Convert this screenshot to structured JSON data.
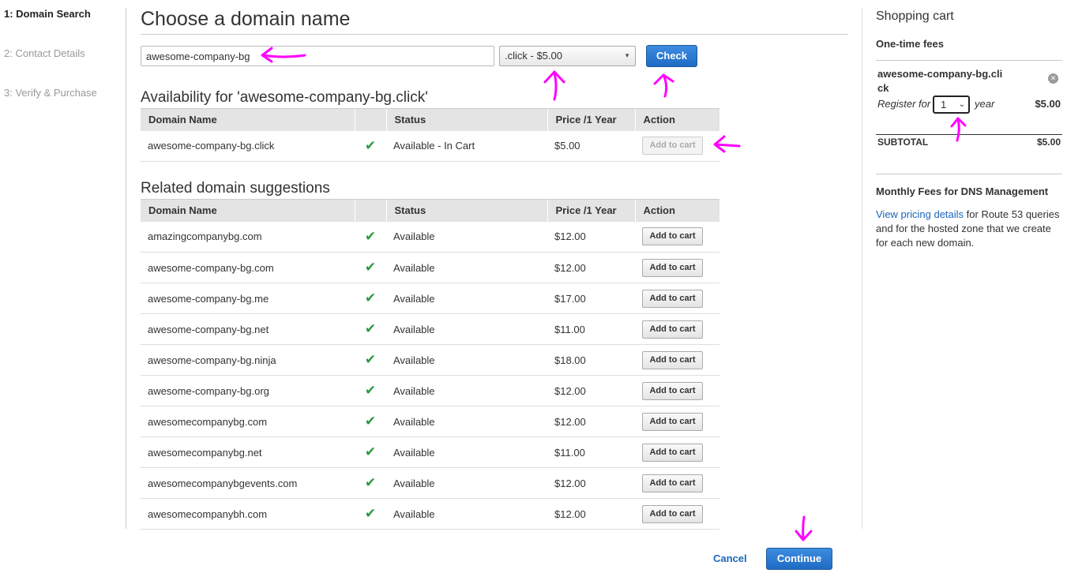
{
  "steps": [
    {
      "label": "1: Domain Search",
      "active": true
    },
    {
      "label": "2: Contact Details",
      "active": false
    },
    {
      "label": "3: Verify & Purchase",
      "active": false
    }
  ],
  "main": {
    "title": "Choose a domain name",
    "search_value": "awesome-company-bg",
    "tld_selected": ".click - $5.00",
    "check_label": "Check"
  },
  "availability": {
    "title": "Availability for 'awesome-company-bg.click'",
    "row": {
      "name": "awesome-company-bg.click",
      "status": "Available - In Cart",
      "price": "$5.00",
      "action": "Add to cart"
    }
  },
  "table_headers": {
    "name": "Domain Name",
    "status": "Status",
    "price": "Price /1 Year",
    "action": "Action"
  },
  "suggestions": {
    "title": "Related domain suggestions",
    "rows": [
      {
        "name": "amazingcompanybg.com",
        "status": "Available",
        "price": "$12.00",
        "action": "Add to cart"
      },
      {
        "name": "awesome-company-bg.com",
        "status": "Available",
        "price": "$12.00",
        "action": "Add to cart"
      },
      {
        "name": "awesome-company-bg.me",
        "status": "Available",
        "price": "$17.00",
        "action": "Add to cart"
      },
      {
        "name": "awesome-company-bg.net",
        "status": "Available",
        "price": "$11.00",
        "action": "Add to cart"
      },
      {
        "name": "awesome-company-bg.ninja",
        "status": "Available",
        "price": "$18.00",
        "action": "Add to cart"
      },
      {
        "name": "awesome-company-bg.org",
        "status": "Available",
        "price": "$12.00",
        "action": "Add to cart"
      },
      {
        "name": "awesomecompanybg.com",
        "status": "Available",
        "price": "$12.00",
        "action": "Add to cart"
      },
      {
        "name": "awesomecompanybg.net",
        "status": "Available",
        "price": "$11.00",
        "action": "Add to cart"
      },
      {
        "name": "awesomecompanybgevents.com",
        "status": "Available",
        "price": "$12.00",
        "action": "Add to cart"
      },
      {
        "name": "awesomecompanybh.com",
        "status": "Available",
        "price": "$12.00",
        "action": "Add to cart"
      }
    ]
  },
  "footer": {
    "cancel_label": "Cancel",
    "continue_label": "Continue"
  },
  "cart": {
    "title": "Shopping cart",
    "one_time_fees": "One-time fees",
    "item_name": "awesome-company-bg.click",
    "register_for": "Register for",
    "years": "1",
    "year_word": "year",
    "item_price": "$5.00",
    "subtotal_label": "SUBTOTAL",
    "subtotal_value": "$5.00",
    "monthly_title": "Monthly Fees for DNS Management",
    "pricing_link": "View pricing details",
    "monthly_text": " for Route 53 queries and for the hosted zone that we create for each new domain."
  },
  "colors": {
    "accent": "#1e6bc4",
    "annotation": "#ff00ff",
    "check_green": "#2c9a3f"
  }
}
